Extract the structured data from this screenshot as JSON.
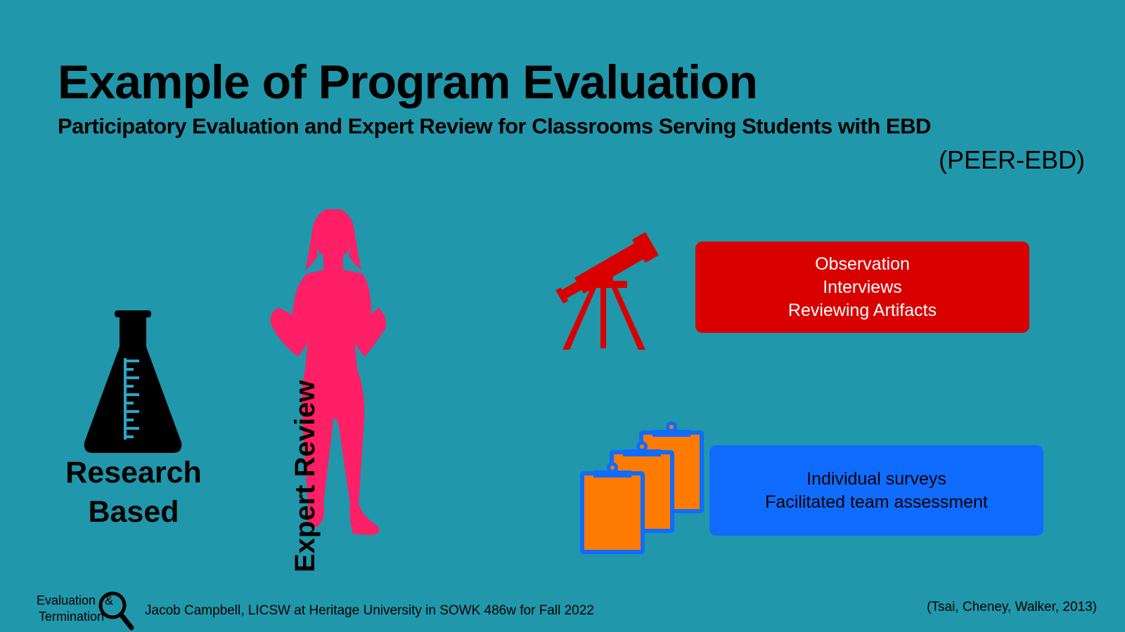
{
  "slide": {
    "title": "Example of Program Evaluation",
    "subtitle": "Participatory Evaluation and Expert Review for Classrooms Serving Students with EBD",
    "acronym": "(PEER-EBD)"
  },
  "left_panel": {
    "research_label_line1": "Research",
    "research_label_line2": "Based",
    "expert_review_label": "Expert Review",
    "icons": [
      "flask-icon",
      "person-silhouette-icon"
    ]
  },
  "methods": {
    "observe": {
      "icon": "telescope-icon",
      "items": [
        "Observation",
        "Interviews",
        "Reviewing Artifacts"
      ]
    },
    "survey": {
      "icon": "clipboards-icon",
      "items": [
        "Individual surveys",
        "Facilitated team assessment"
      ]
    }
  },
  "footer": {
    "badge_line1": "Evaluation",
    "badge_amp": "&",
    "badge_line2": "Termination",
    "credit": "Jacob Campbell, LICSW at Heritage University in SOWK 486w for Fall 2022",
    "citation": "(Tsai, Cheney, Walker, 2013)"
  },
  "colors": {
    "background": "#2097ab",
    "observe_box": "#d90000",
    "survey_box": "#0f6cff",
    "silhouette": "#ff1f66",
    "telescope": "#d90000",
    "clipboard_fill": "#ff7a00",
    "clipboard_border": "#0f6cff"
  }
}
